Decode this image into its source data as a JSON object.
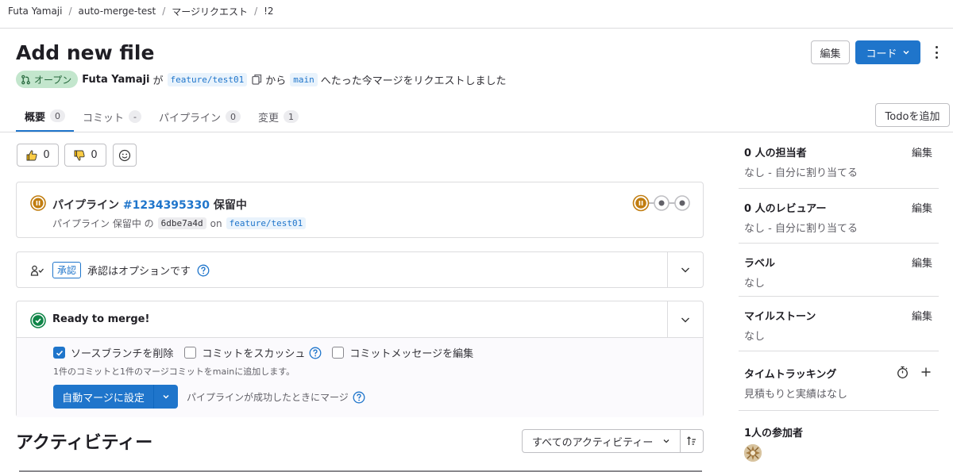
{
  "breadcrumb": [
    "Futa Yamaji",
    "auto-merge-test",
    "マージリクエスト",
    "!2"
  ],
  "header": {
    "title": "Add new file",
    "edit_label": "編集",
    "code_label": "コード"
  },
  "status": {
    "badge": "オープン",
    "author": "Futa Yamaji",
    "by": "が",
    "source_branch": "feature/test01",
    "from": "から",
    "target_branch": "main",
    "suffix": "へたった今マージをリクエストしました"
  },
  "tabs": [
    {
      "label": "概要",
      "count": "0"
    },
    {
      "label": "コミット",
      "count": "-"
    },
    {
      "label": "パイプライン",
      "count": "0"
    },
    {
      "label": "変更",
      "count": "1"
    }
  ],
  "todo_label": "Todoを追加",
  "reactions": {
    "thumbs_up": "0",
    "thumbs_down": "0"
  },
  "pipeline": {
    "label": "パイプライン",
    "id": "#1234395330",
    "status": "保留中",
    "sub_prefix": "パイプライン 保留中 の",
    "sha": "6dbe7a4d",
    "on": "on",
    "branch": "feature/test01"
  },
  "approval": {
    "badge": "承認",
    "text": "承認はオプションです"
  },
  "merge": {
    "title": "Ready to merge!",
    "options": [
      {
        "label": "ソースブランチを削除",
        "checked": true
      },
      {
        "label": "コミットをスカッシュ",
        "checked": false
      },
      {
        "label": "コミットメッセージを編集",
        "checked": false
      }
    ],
    "note": "1件のコミットと1件のマージコミットをmainに追加します。",
    "auto_button": "自動マージに設定",
    "auto_note": "パイプラインが成功したときにマージ"
  },
  "activity": {
    "title": "アクティビティー",
    "filter": "すべてのアクティビティー"
  },
  "sidebar": {
    "edit_label": "編集",
    "assignees": {
      "title": "0 人の担当者",
      "value": "なし - 自分に割り当てる"
    },
    "reviewers": {
      "title": "0 人のレビュアー",
      "value": "なし - 自分に割り当てる"
    },
    "labels": {
      "title": "ラベル",
      "value": "なし"
    },
    "milestone": {
      "title": "マイルストーン",
      "value": "なし"
    },
    "time_tracking": {
      "title": "タイムトラッキング",
      "value": "見積もりと実績はなし"
    },
    "participants": {
      "title": "1人の参加者"
    }
  },
  "colors": {
    "accent": "#1f75cb",
    "open_bg": "#c3e6cd",
    "pending": "#c17d10",
    "success": "#108548"
  }
}
